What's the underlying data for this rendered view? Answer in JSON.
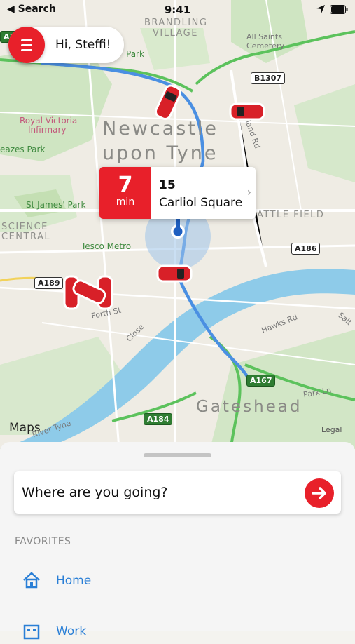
{
  "status_bar": {
    "back_label": "◀ Search",
    "time": "9:41"
  },
  "greeting": {
    "text": "Hi, Steffi!"
  },
  "map": {
    "city_lines": [
      "Newcastle",
      "upon Tyne"
    ],
    "gateshead": "Gateshead",
    "areas": [
      "BRANDLING",
      "VILLAGE",
      "SCIENCE",
      "CENTRAL",
      "ATTLE FIELD"
    ],
    "places": [
      "Royal Victoria",
      "Infirmary",
      "All Saints",
      "Cemetery",
      "St James' Park",
      "Tesco Metro",
      "eazes Park",
      "Park"
    ],
    "streets": [
      "Forth St",
      "Close",
      "Hawks Rd",
      "Park Ln",
      "River Tyne",
      "land Rd",
      "Salt"
    ],
    "shields": [
      "B1307",
      "A186",
      "A189",
      "A167",
      "A184",
      "A167"
    ],
    "maps_label": "Maps",
    "legal_label": "Legal"
  },
  "station": {
    "minutes": "7",
    "min_label": "min",
    "number": "15",
    "name": "Carliol Square"
  },
  "sheet": {
    "search_label": "Where are you going?",
    "favorites_heading": "FAVORITES",
    "favorites": [
      {
        "label": "Home",
        "icon": "home-icon"
      },
      {
        "label": "Work",
        "icon": "work-icon"
      }
    ]
  },
  "colors": {
    "accent": "#e8202a",
    "link": "#2a7fd6",
    "route": "#4a8fe2",
    "river": "#7ec3e8"
  }
}
